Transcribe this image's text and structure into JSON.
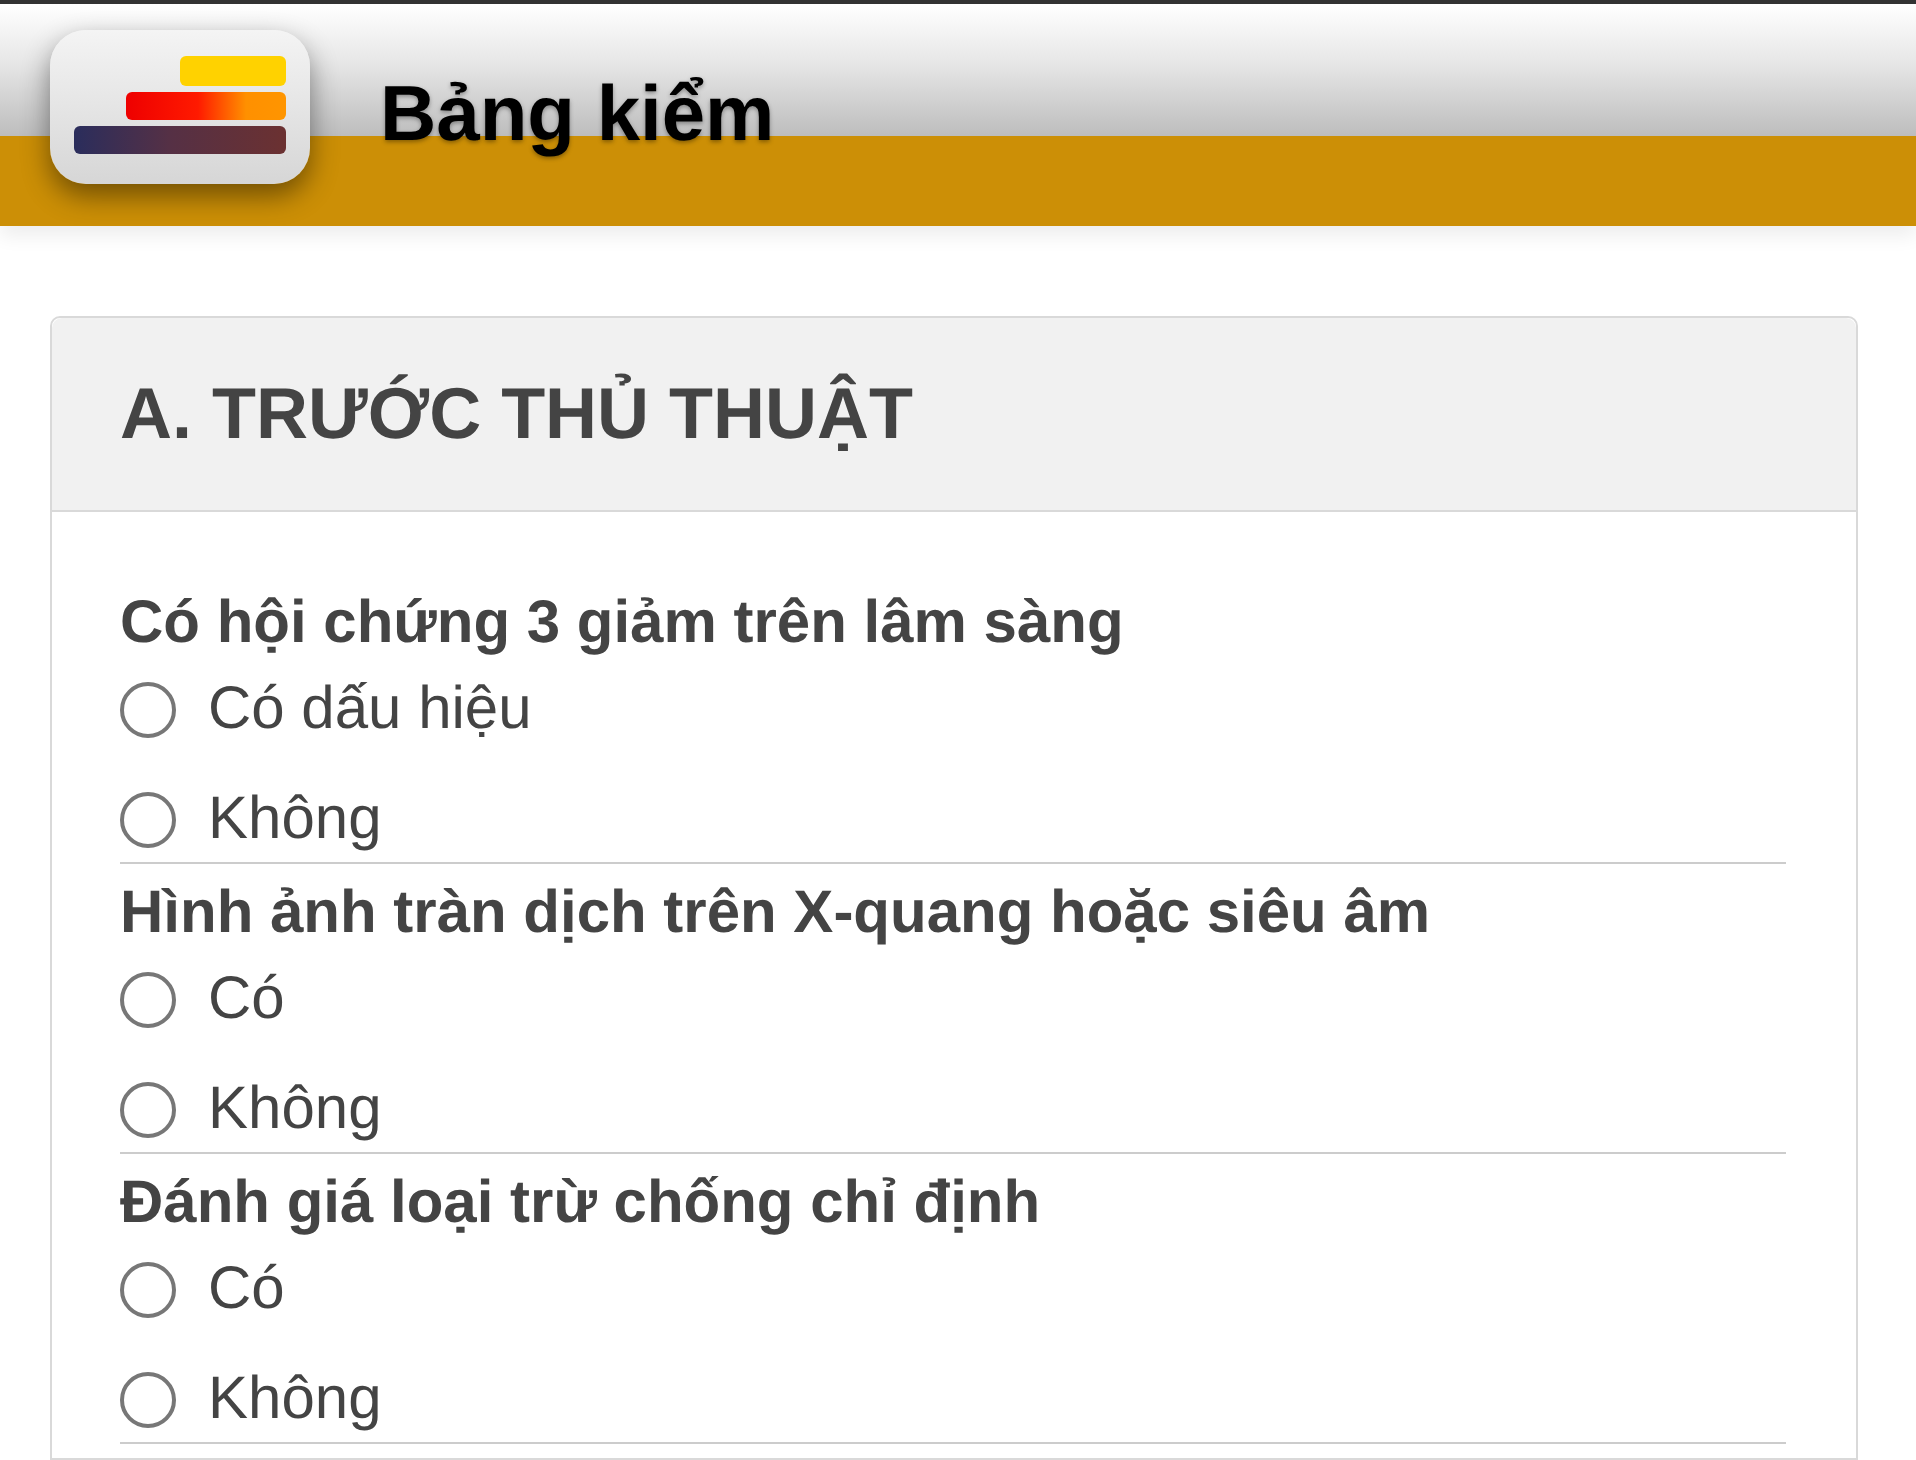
{
  "header": {
    "title": "Bảng kiểm"
  },
  "section": {
    "title": "A. TRƯỚC THỦ THUẬT",
    "questions": [
      {
        "text": "Có hội chứng 3 giảm trên lâm sàng",
        "options": [
          {
            "label": "Có dấu hiệu",
            "selected": false
          },
          {
            "label": "Không",
            "selected": false
          }
        ]
      },
      {
        "text": "Hình ảnh tràn dịch trên X-quang hoặc siêu âm",
        "options": [
          {
            "label": "Có",
            "selected": false
          },
          {
            "label": "Không",
            "selected": false
          }
        ]
      },
      {
        "text": "Đánh giá loại trừ chống chỉ định",
        "options": [
          {
            "label": "Có",
            "selected": false
          },
          {
            "label": "Không",
            "selected": false
          }
        ]
      }
    ]
  }
}
